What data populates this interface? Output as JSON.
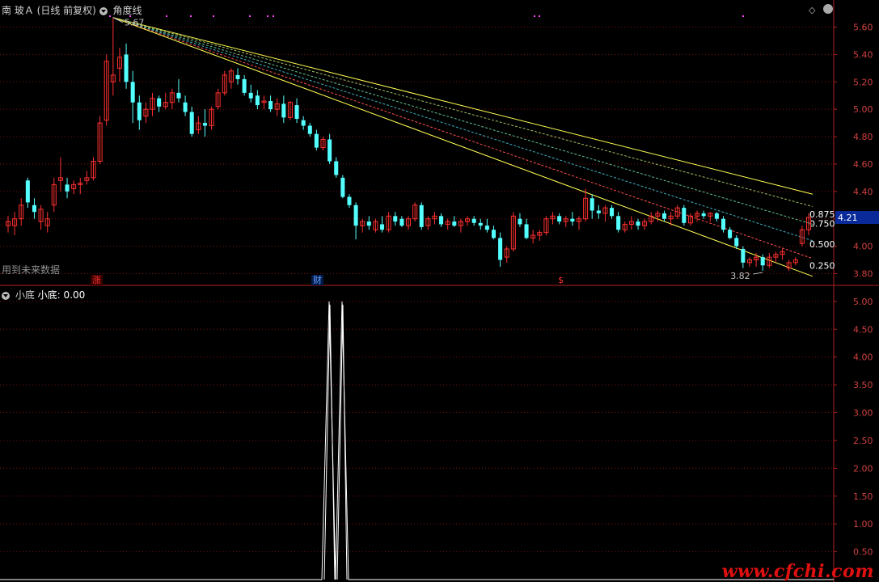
{
  "header": {
    "stock_name": "南 玻Ａ",
    "period_label": "(日线 前复权)",
    "indicator_name": "角度线"
  },
  "main_chart": {
    "y_ticks": [
      "5.60",
      "5.40",
      "5.20",
      "5.00",
      "4.80",
      "4.60",
      "4.40",
      "4.20",
      "4.00",
      "3.80"
    ],
    "y_range": [
      3.72,
      5.68
    ],
    "high_label": "5.67",
    "low_label": "3.82",
    "current_price": "4.21",
    "fib_labels": [
      "0.875",
      "0.750",
      "0.500",
      "0.250"
    ],
    "future_data_note": "用到未来数据",
    "event_markers": [
      "涨",
      "财",
      "$"
    ],
    "colors": {
      "up": "#ff3030",
      "down": "#54ffff",
      "fan_yellow": "#ffff54",
      "fan_red": "#ff5050"
    }
  },
  "sub_chart": {
    "title": "小底",
    "value_label": "小底: 0.00",
    "y_ticks": [
      "5.00",
      "4.50",
      "4.00",
      "3.50",
      "3.00",
      "2.50",
      "2.00",
      "1.50",
      "1.00",
      "0.50"
    ],
    "y_range": [
      0,
      5.1
    ],
    "series_value": 5.0
  },
  "watermark": "www.cfchi.com",
  "chart_data": {
    "type": "candlestick",
    "ylim": [
      3.72,
      5.68
    ],
    "candles": [
      [
        4.15,
        4.22,
        4.1,
        4.18
      ],
      [
        4.15,
        4.25,
        4.08,
        4.2
      ],
      [
        4.2,
        4.35,
        4.15,
        4.3
      ],
      [
        4.48,
        4.5,
        4.28,
        4.32
      ],
      [
        4.3,
        4.35,
        4.2,
        4.25
      ],
      [
        4.18,
        4.3,
        4.12,
        4.27
      ],
      [
        4.15,
        4.25,
        4.1,
        4.2
      ],
      [
        4.3,
        4.5,
        4.25,
        4.45
      ],
      [
        4.48,
        4.65,
        4.4,
        4.5
      ],
      [
        4.45,
        4.5,
        4.35,
        4.4
      ],
      [
        4.42,
        4.48,
        4.38,
        4.45
      ],
      [
        4.45,
        4.5,
        4.38,
        4.46
      ],
      [
        4.48,
        4.55,
        4.45,
        4.5
      ],
      [
        4.5,
        4.65,
        4.48,
        4.62
      ],
      [
        4.62,
        4.95,
        4.6,
        4.9
      ],
      [
        4.92,
        5.4,
        4.88,
        5.35
      ],
      [
        5.2,
        5.67,
        5.1,
        5.25
      ],
      [
        5.3,
        5.45,
        5.2,
        5.38
      ],
      [
        5.4,
        5.48,
        5.15,
        5.2
      ],
      [
        5.2,
        5.28,
        4.9,
        5.05
      ],
      [
        5.05,
        5.1,
        4.85,
        4.92
      ],
      [
        4.95,
        5.05,
        4.9,
        5.0
      ],
      [
        5.0,
        5.12,
        4.95,
        5.08
      ],
      [
        5.08,
        5.1,
        4.98,
        5.02
      ],
      [
        5.02,
        5.12,
        5.0,
        5.05
      ],
      [
        5.05,
        5.15,
        5.0,
        5.12
      ],
      [
        5.12,
        5.22,
        5.05,
        5.08
      ],
      [
        5.05,
        5.1,
        4.95,
        4.98
      ],
      [
        4.98,
        5.02,
        4.8,
        4.82
      ],
      [
        4.85,
        4.95,
        4.82,
        4.9
      ],
      [
        4.9,
        5.0,
        4.8,
        4.88
      ],
      [
        4.88,
        5.02,
        4.85,
        5.0
      ],
      [
        5.02,
        5.15,
        5.0,
        5.12
      ],
      [
        5.12,
        5.28,
        5.1,
        5.25
      ],
      [
        5.2,
        5.3,
        5.15,
        5.28
      ],
      [
        5.25,
        5.3,
        5.18,
        5.22
      ],
      [
        5.22,
        5.25,
        5.1,
        5.12
      ],
      [
        5.12,
        5.18,
        5.05,
        5.08
      ],
      [
        5.1,
        5.14,
        5.0,
        5.03
      ],
      [
        5.05,
        5.1,
        5.0,
        5.06
      ],
      [
        5.06,
        5.1,
        4.98,
        5.0
      ],
      [
        5.0,
        5.08,
        4.95,
        5.04
      ],
      [
        5.04,
        5.1,
        4.9,
        4.94
      ],
      [
        4.94,
        5.06,
        4.92,
        5.05
      ],
      [
        5.03,
        5.08,
        4.9,
        4.93
      ],
      [
        4.92,
        4.95,
        4.85,
        4.88
      ],
      [
        4.88,
        4.9,
        4.8,
        4.82
      ],
      [
        4.82,
        4.85,
        4.7,
        4.72
      ],
      [
        4.72,
        4.8,
        4.7,
        4.78
      ],
      [
        4.78,
        4.82,
        4.6,
        4.62
      ],
      [
        4.62,
        4.65,
        4.5,
        4.52
      ],
      [
        4.5,
        4.52,
        4.35,
        4.36
      ],
      [
        4.36,
        4.38,
        4.28,
        4.3
      ],
      [
        4.3,
        4.32,
        4.05,
        4.15
      ],
      [
        4.15,
        4.2,
        4.1,
        4.18
      ],
      [
        4.18,
        4.22,
        4.12,
        4.15
      ],
      [
        4.12,
        4.2,
        4.1,
        4.18
      ],
      [
        4.16,
        4.22,
        4.1,
        4.12
      ],
      [
        4.12,
        4.25,
        4.1,
        4.22
      ],
      [
        4.22,
        4.25,
        4.15,
        4.18
      ],
      [
        4.2,
        4.22,
        4.14,
        4.15
      ],
      [
        4.15,
        4.22,
        4.12,
        4.2
      ],
      [
        4.2,
        4.32,
        4.18,
        4.3
      ],
      [
        4.3,
        4.32,
        4.12,
        4.14
      ],
      [
        4.15,
        4.22,
        4.12,
        4.2
      ],
      [
        4.2,
        4.25,
        4.16,
        4.22
      ],
      [
        4.22,
        4.24,
        4.14,
        4.16
      ],
      [
        4.16,
        4.2,
        4.12,
        4.18
      ],
      [
        4.18,
        4.22,
        4.14,
        4.15
      ],
      [
        4.15,
        4.2,
        4.1,
        4.18
      ],
      [
        4.18,
        4.22,
        4.15,
        4.2
      ],
      [
        4.2,
        4.22,
        4.15,
        4.17
      ],
      [
        4.17,
        4.2,
        4.12,
        4.15
      ],
      [
        4.15,
        4.2,
        4.1,
        4.12
      ],
      [
        4.12,
        4.15,
        4.05,
        4.06
      ],
      [
        4.06,
        4.1,
        3.85,
        3.9
      ],
      [
        3.92,
        4.0,
        3.88,
        3.98
      ],
      [
        3.98,
        4.25,
        3.96,
        4.22
      ],
      [
        4.2,
        4.24,
        4.14,
        4.16
      ],
      [
        4.16,
        4.2,
        4.05,
        4.06
      ],
      [
        4.06,
        4.12,
        4.02,
        4.08
      ],
      [
        4.08,
        4.12,
        4.04,
        4.1
      ],
      [
        4.1,
        4.22,
        4.08,
        4.2
      ],
      [
        4.2,
        4.25,
        4.16,
        4.22
      ],
      [
        4.22,
        4.24,
        4.16,
        4.18
      ],
      [
        4.18,
        4.22,
        4.14,
        4.2
      ],
      [
        4.2,
        4.25,
        4.15,
        4.18
      ],
      [
        4.18,
        4.22,
        4.12,
        4.2
      ],
      [
        4.2,
        4.42,
        4.18,
        4.35
      ],
      [
        4.35,
        4.38,
        4.2,
        4.26
      ],
      [
        4.26,
        4.3,
        4.2,
        4.24
      ],
      [
        4.24,
        4.3,
        4.18,
        4.28
      ],
      [
        4.28,
        4.3,
        4.2,
        4.22
      ],
      [
        4.22,
        4.25,
        4.1,
        4.12
      ],
      [
        4.12,
        4.18,
        4.1,
        4.16
      ],
      [
        4.16,
        4.22,
        4.12,
        4.18
      ],
      [
        4.18,
        4.2,
        4.12,
        4.15
      ],
      [
        4.15,
        4.2,
        4.12,
        4.18
      ],
      [
        4.18,
        4.25,
        4.16,
        4.22
      ],
      [
        4.22,
        4.26,
        4.18,
        4.24
      ],
      [
        4.24,
        4.26,
        4.18,
        4.2
      ],
      [
        4.2,
        4.25,
        4.15,
        4.22
      ],
      [
        4.22,
        4.3,
        4.2,
        4.28
      ],
      [
        4.28,
        4.3,
        4.15,
        4.17
      ],
      [
        4.17,
        4.24,
        4.15,
        4.22
      ],
      [
        4.22,
        4.26,
        4.18,
        4.24
      ],
      [
        4.24,
        4.26,
        4.2,
        4.22
      ],
      [
        4.22,
        4.25,
        4.18,
        4.24
      ],
      [
        4.24,
        4.25,
        4.18,
        4.2
      ],
      [
        4.2,
        4.22,
        4.1,
        4.12
      ],
      [
        4.12,
        4.14,
        4.05,
        4.06
      ],
      [
        4.06,
        4.08,
        3.98,
        4.0
      ],
      [
        3.98,
        4.0,
        3.84,
        3.88
      ],
      [
        3.88,
        3.92,
        3.85,
        3.9
      ],
      [
        3.9,
        3.95,
        3.85,
        3.92
      ],
      [
        3.92,
        3.94,
        3.82,
        3.86
      ],
      [
        3.86,
        3.95,
        3.84,
        3.92
      ],
      [
        3.92,
        3.96,
        3.88,
        3.94
      ],
      [
        3.94,
        3.98,
        3.9,
        3.96
      ],
      [
        3.84,
        3.9,
        3.82,
        3.88
      ],
      [
        3.88,
        3.92,
        3.86,
        3.9
      ],
      [
        4.02,
        4.15,
        4.0,
        4.12
      ],
      [
        4.12,
        4.24,
        4.08,
        4.21
      ]
    ],
    "fan_from": [
      5.67
    ],
    "series": [
      {
        "values": [
          0,
          5,
          5,
          0
        ]
      }
    ]
  }
}
